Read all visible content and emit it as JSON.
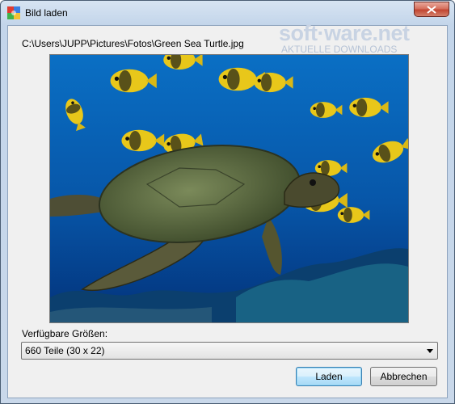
{
  "window": {
    "title": "Bild laden",
    "icon": "puzzle-app-icon"
  },
  "file_path": "C:\\Users\\JUPP\\Pictures\\Fotos\\Green Sea Turtle.jpg",
  "watermark": {
    "brand": "soft·ware.net",
    "subtitle": "AKTUELLE DOWNLOADS"
  },
  "sizes": {
    "label": "Verfügbare Größen:",
    "selected": "660 Teile (30 x 22)"
  },
  "buttons": {
    "load": "Laden",
    "cancel": "Abbrechen"
  },
  "colors": {
    "accent": "#3c7fb1",
    "close": "#c24632",
    "water": "#0a6fc4"
  }
}
